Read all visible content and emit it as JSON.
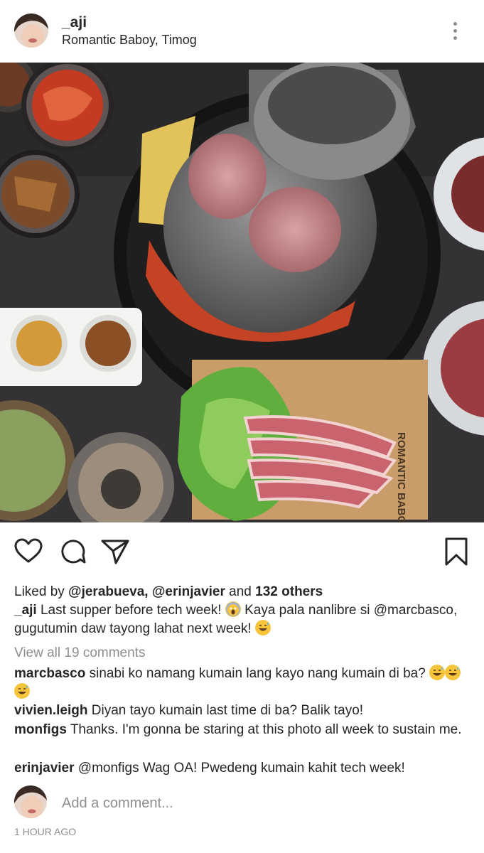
{
  "post": {
    "username": "_aji",
    "location": "Romantic Baboy, Timog",
    "board_brand": "ROMANTIC BABOY",
    "liked_prefix": "Liked by ",
    "liked_user1": "@jerabueva,",
    "liked_user2": "@erinjavier",
    "liked_and": " and ",
    "liked_count": "132 others",
    "caption_user": "_aji",
    "caption_text1": " Last supper before tech week! ",
    "caption_text2": " Kaya pala nanlibre si @marcbasco, gugutumin daw tayong lahat next week! ",
    "view_all": "View all 19 comments",
    "comments": [
      {
        "user": "marcbasco",
        "text": " sinabi ko namang kumain lang kayo nang kumain di ba? "
      },
      {
        "user": "vivien.leigh",
        "text": " Diyan tayo kumain last time di ba? Balik tayo!"
      },
      {
        "user": "monfigs",
        "text": " Thanks. I'm gonna be staring at this photo all week to sustain me."
      },
      {
        "user": "erinjavier",
        "text": " @monfigs Wag OA! Pwedeng kumain kahit tech week!"
      }
    ],
    "add_comment_placeholder": "Add a comment...",
    "timestamp": "1 HOUR AGO"
  },
  "icons": {
    "like": "heart-icon",
    "comment": "comment-bubble-icon",
    "share": "paper-plane-icon",
    "save": "bookmark-icon",
    "more": "three-dots-vertical-icon"
  },
  "colors": {
    "text": "#262626",
    "muted": "#8e8e8e",
    "emoji": "#f7c53b"
  }
}
